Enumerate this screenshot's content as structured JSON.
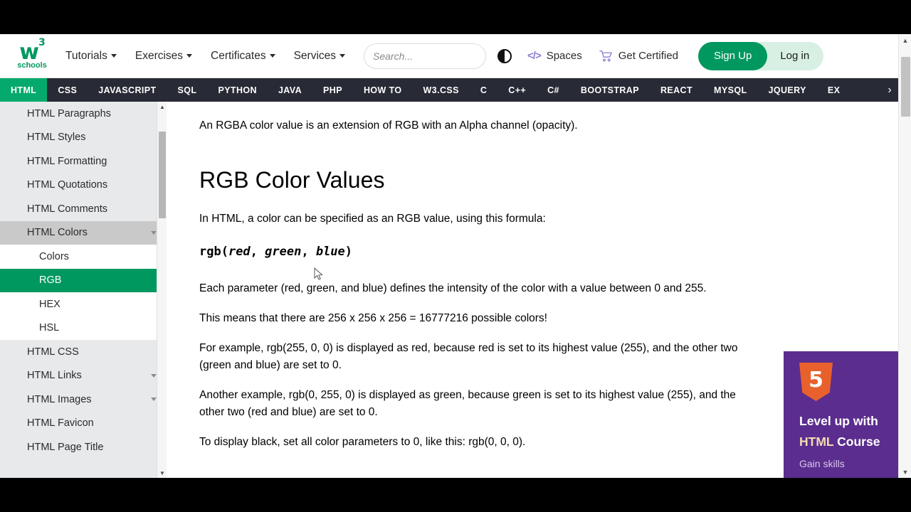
{
  "header": {
    "logo": {
      "main": "w",
      "sup": "3",
      "sub": "schools"
    },
    "nav": [
      {
        "label": "Tutorials"
      },
      {
        "label": "Exercises"
      },
      {
        "label": "Certificates"
      },
      {
        "label": "Services"
      }
    ],
    "search": {
      "value": "",
      "placeholder": "Search...",
      "icon": "search-icon"
    },
    "dark_mode_icon": "contrast-circle-icon",
    "spaces": {
      "label": "Spaces",
      "icon": "code-brackets-icon"
    },
    "get_certified": {
      "label": "Get Certified",
      "icon": "shopping-cart-icon"
    },
    "sign_up": "Sign Up",
    "log_in": "Log in"
  },
  "tabbar": {
    "items": [
      {
        "label": "HTML",
        "active": true
      },
      {
        "label": "CSS",
        "active": false
      },
      {
        "label": "JAVASCRIPT",
        "active": false
      },
      {
        "label": "SQL",
        "active": false
      },
      {
        "label": "PYTHON",
        "active": false
      },
      {
        "label": "JAVA",
        "active": false
      },
      {
        "label": "PHP",
        "active": false
      },
      {
        "label": "HOW TO",
        "active": false
      },
      {
        "label": "W3.CSS",
        "active": false
      },
      {
        "label": "C",
        "active": false
      },
      {
        "label": "C++",
        "active": false
      },
      {
        "label": "C#",
        "active": false
      },
      {
        "label": "BOOTSTRAP",
        "active": false
      },
      {
        "label": "REACT",
        "active": false
      },
      {
        "label": "MYSQL",
        "active": false
      },
      {
        "label": "JQUERY",
        "active": false
      },
      {
        "label": "EX",
        "active": false
      }
    ],
    "scroll_right_icon": "chevron-right-icon"
  },
  "sidebar": {
    "items": [
      {
        "label": "HTML Paragraphs",
        "type": "item"
      },
      {
        "label": "HTML Styles",
        "type": "item"
      },
      {
        "label": "HTML Formatting",
        "type": "item"
      },
      {
        "label": "HTML Quotations",
        "type": "item"
      },
      {
        "label": "HTML Comments",
        "type": "item"
      },
      {
        "label": "HTML Colors",
        "type": "parent-open",
        "chevron": "chevron-down-icon"
      },
      {
        "label": "Colors",
        "type": "sub"
      },
      {
        "label": "RGB",
        "type": "sub-active"
      },
      {
        "label": "HEX",
        "type": "sub"
      },
      {
        "label": "HSL",
        "type": "sub"
      },
      {
        "label": "HTML CSS",
        "type": "item"
      },
      {
        "label": "HTML Links",
        "type": "item",
        "chevron": "chevron-down-icon"
      },
      {
        "label": "HTML Images",
        "type": "item",
        "chevron": "chevron-down-icon"
      },
      {
        "label": "HTML Favicon",
        "type": "item"
      },
      {
        "label": "HTML Page Title",
        "type": "item"
      }
    ],
    "scrollbar": {
      "up_icon": "triangle-up-icon",
      "down_icon": "triangle-down-icon"
    }
  },
  "content": {
    "intro": "An RGBA color value is an extension of RGB with an Alpha channel (opacity).",
    "heading": "RGB Color Values",
    "p1": "In HTML, a color can be specified as an RGB value, using this formula:",
    "formula": {
      "prefix": "rgb(",
      "red": "red",
      "sep1": ", ",
      "green": "green",
      "sep2": ", ",
      "blue": "blue",
      "suffix": ")"
    },
    "p2": "Each parameter (red, green, and blue) defines the intensity of the color with a value between 0 and 255.",
    "p3": "This means that there are 256 x 256 x 256 = 16777216 possible colors!",
    "p4": "For example, rgb(255, 0, 0) is displayed as red, because red is set to its highest value (255), and the other two (green and blue) are set to 0.",
    "p5": "Another example, rgb(0, 255, 0) is displayed as green, because green is set to its highest value (255), and the other two (red and blue) are set to 0.",
    "p6": "To display black, set all color parameters to 0, like this: rgb(0, 0, 0)."
  },
  "ad": {
    "logo_text": "5",
    "line1": "Level up with",
    "line2_highlight": "HTML",
    "line2_rest": " Course",
    "line3": "Gain skills"
  },
  "scrollbar": {
    "up_icon": "triangle-up-icon",
    "down_icon": "triangle-down-icon"
  },
  "colors": {
    "brand_green": "#04AA6D",
    "dark_green": "#00985F",
    "navbar_dark": "#282A35",
    "sidebar_bg": "#E7E9EB",
    "ad_purple": "#5B2D8E",
    "accent_purple": "#8A7FD4"
  }
}
